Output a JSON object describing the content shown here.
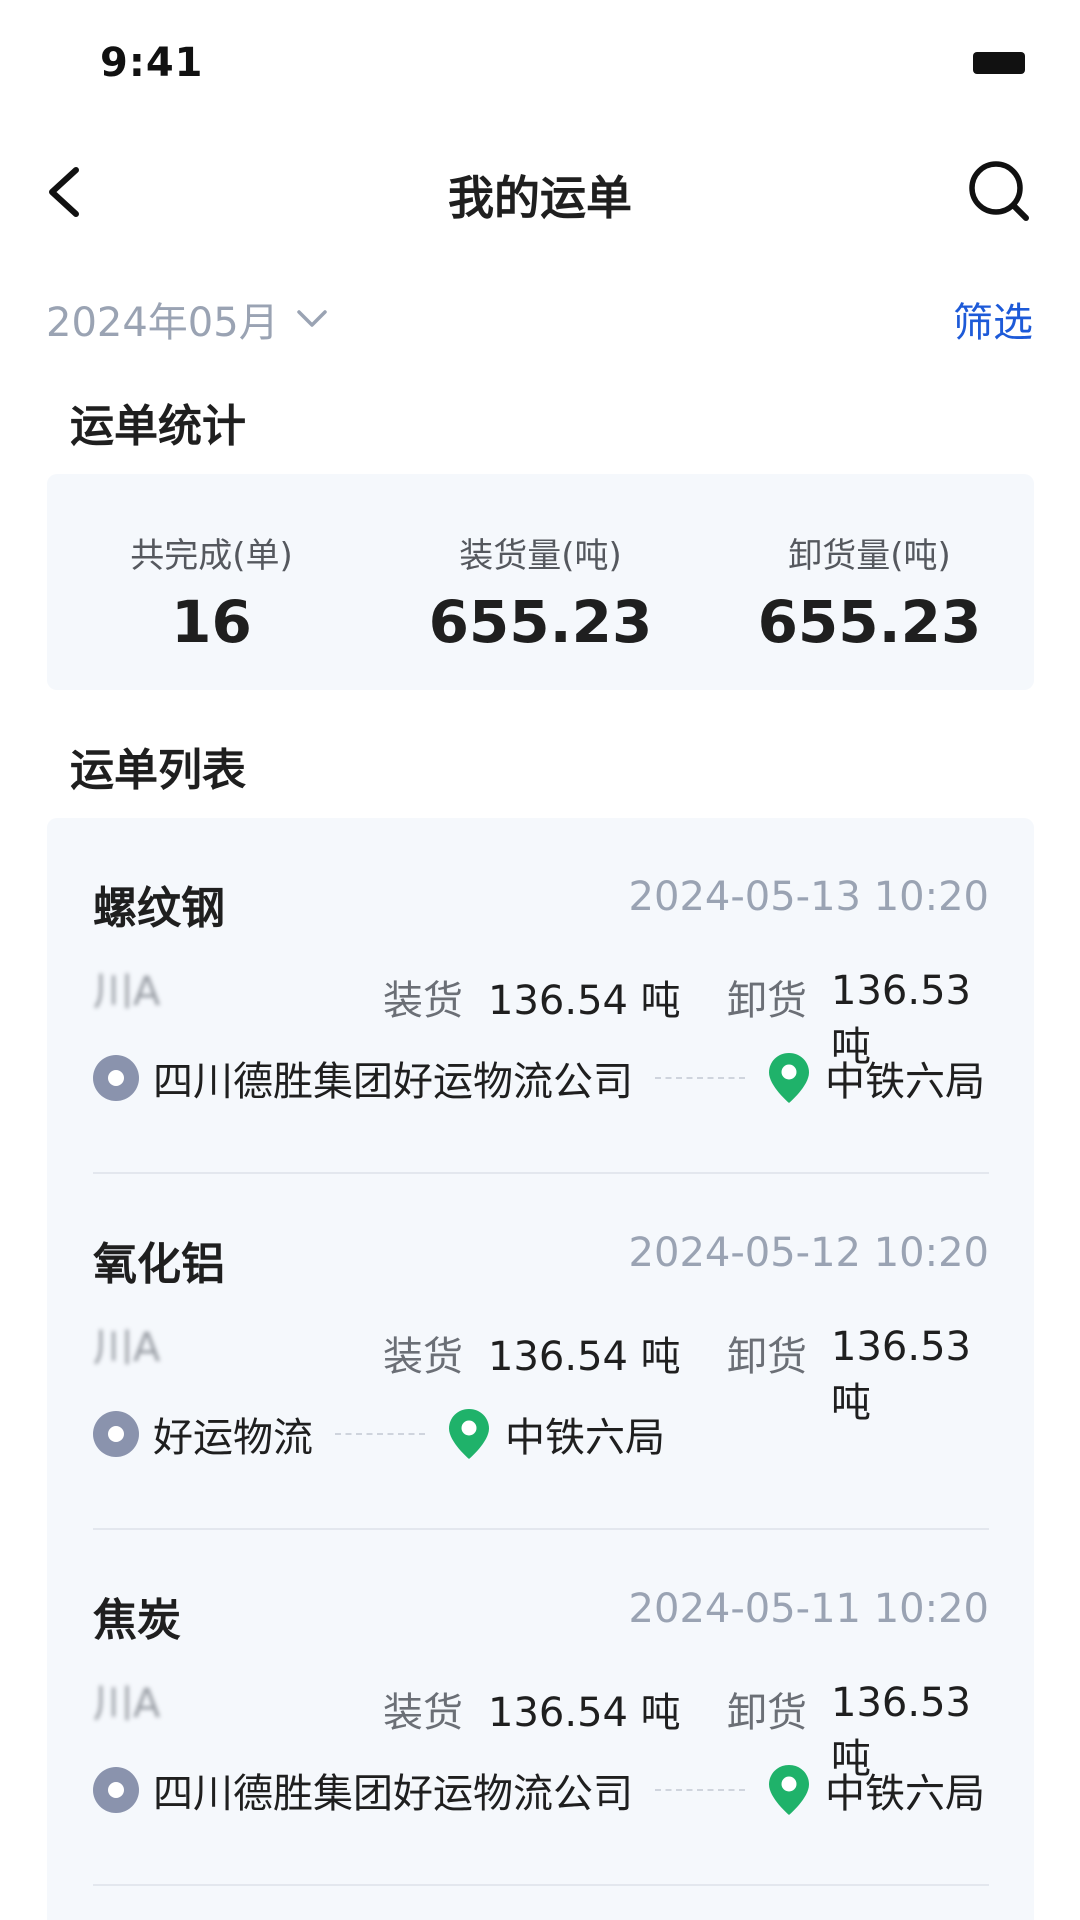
{
  "status_bar": {
    "time": "9:41"
  },
  "header": {
    "title": "我的运单"
  },
  "filter": {
    "month": "2024年05月",
    "filter_label": "筛选"
  },
  "stats_section": {
    "title": "运单统计",
    "items": [
      {
        "label": "共完成(单)",
        "value": "16"
      },
      {
        "label": "装货量(吨)",
        "value": "655.23"
      },
      {
        "label": "卸货量(吨)",
        "value": "655.23"
      }
    ]
  },
  "list_section": {
    "title": "运单列表",
    "orders": [
      {
        "title": "螺纹钢",
        "date": "2024-05-13 10:20",
        "plate": "川A 50502D",
        "load_label": "装货",
        "load_value": "136.54 吨",
        "unload_label": "卸货",
        "unload_value": "136.53吨",
        "origin": "四川德胜集团好运物流公司",
        "destination": "中铁六局"
      },
      {
        "title": "氧化铝",
        "date": "2024-05-12 10:20",
        "plate": "川A 50502D",
        "load_label": "装货",
        "load_value": "136.54 吨",
        "unload_label": "卸货",
        "unload_value": "136.53吨",
        "origin": "好运物流",
        "destination": "中铁六局"
      },
      {
        "title": "焦炭",
        "date": "2024-05-11 10:20",
        "plate": "川A 50502D",
        "load_label": "装货",
        "load_value": "136.54 吨",
        "unload_label": "卸货",
        "unload_value": "136.53吨",
        "origin": "四川德胜集团好运物流公司",
        "destination": "中铁六局"
      }
    ]
  },
  "colors": {
    "accent": "#1d5ad8",
    "card_background": "#f5f8fc",
    "muted_text": "#9aa3b3",
    "origin_marker": "#8a93ad",
    "destination_marker": "#1fb26a"
  },
  "icons": {
    "back": "back-arrow-icon",
    "search": "search-icon",
    "dropdown": "chevron-down-icon",
    "origin": "origin-dot-icon",
    "destination": "location-pin-icon",
    "battery": "battery-icon"
  }
}
